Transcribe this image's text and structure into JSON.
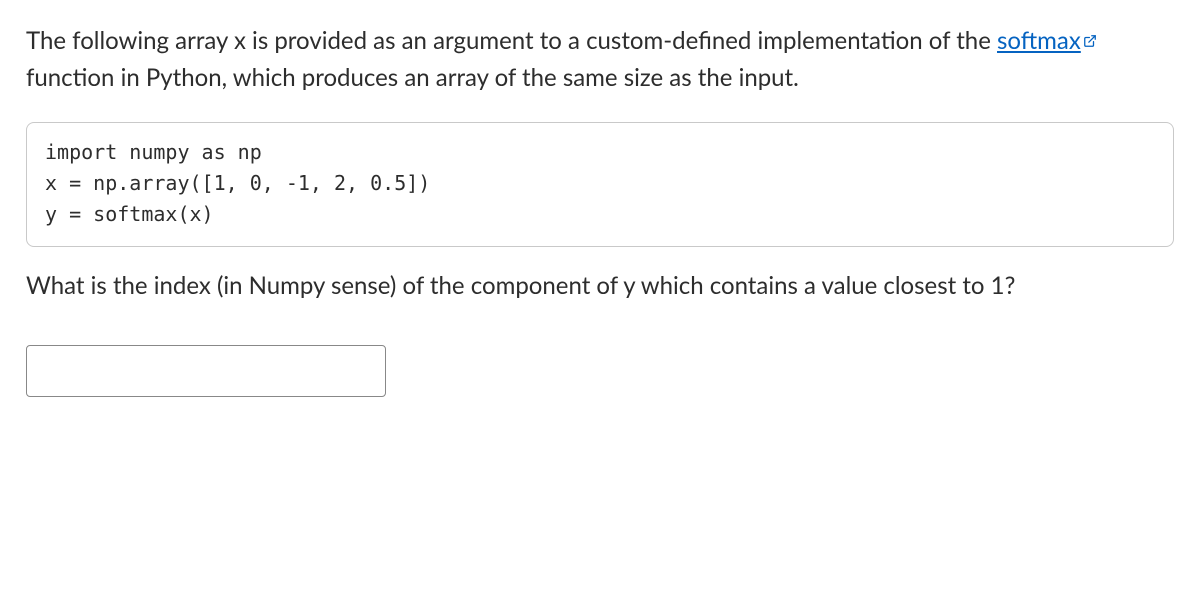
{
  "intro": {
    "pre_link": "The following array x is provided as an argument to a custom-defined implementation of the ",
    "link_text": "softmax",
    "post_link": " function in Python, which produces an array of the same size as the input."
  },
  "code": "import numpy as np\nx = np.array([1, 0, -1, 2, 0.5])\ny = softmax(x)",
  "question": "What is the index (in Numpy sense) of the component of y which contains a value closest to 1?",
  "answer_value": ""
}
